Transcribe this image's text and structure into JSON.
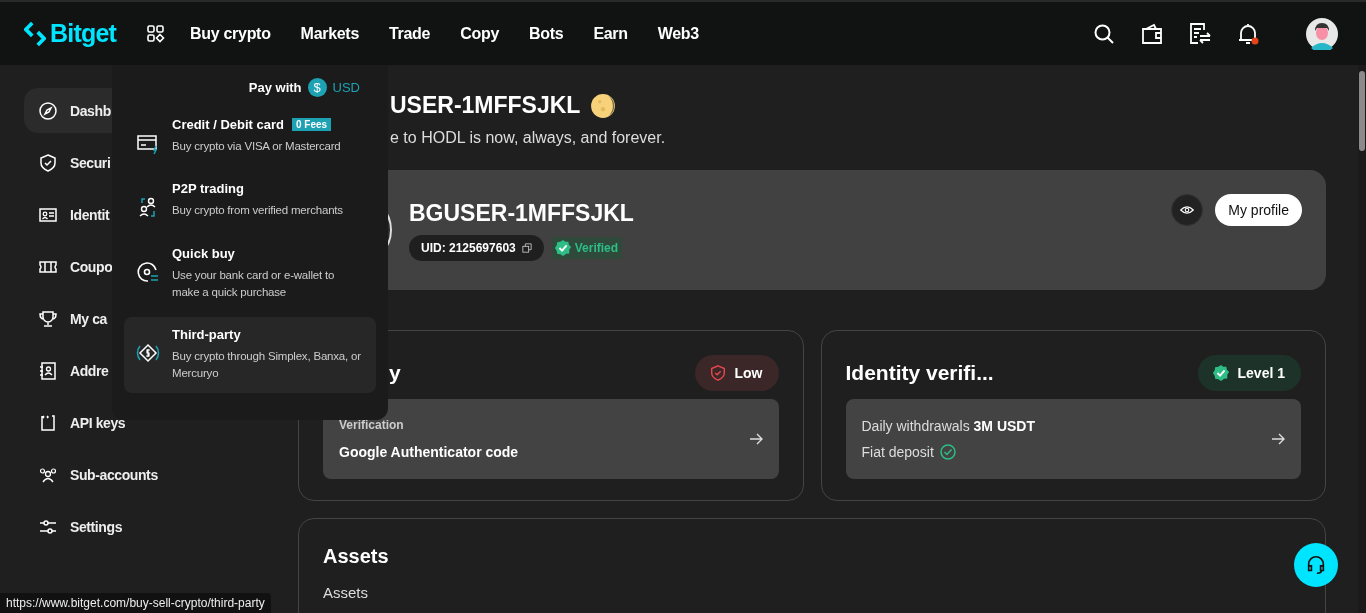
{
  "top_bar": {
    "logo": "Bitget",
    "nav": [
      {
        "label": "Buy crypto"
      },
      {
        "label": "Markets"
      },
      {
        "label": "Trade"
      },
      {
        "label": "Copy"
      },
      {
        "label": "Bots"
      },
      {
        "label": "Earn"
      },
      {
        "label": "Web3"
      }
    ],
    "notification_dot": true
  },
  "sidebar": {
    "items": [
      {
        "label": "Dashb",
        "kind": "compass",
        "selected": true
      },
      {
        "label": "Securi",
        "kind": "shield",
        "selected": false
      },
      {
        "label": "Identit",
        "kind": "idcard",
        "selected": false
      },
      {
        "label": "Coupo",
        "kind": "ticket",
        "selected": false
      },
      {
        "label": "My ca",
        "kind": "trophy",
        "selected": false
      },
      {
        "label": "Addre",
        "kind": "book",
        "selected": false
      },
      {
        "label": "API keys",
        "kind": "api",
        "selected": false
      },
      {
        "label": "Sub-accounts",
        "kind": "people",
        "selected": false
      },
      {
        "label": "Settings",
        "kind": "sliders",
        "selected": false
      }
    ]
  },
  "greeting": {
    "name": "USER-1MFFSJKL",
    "subtitle": "e to HODL is now, always, and forever."
  },
  "profile": {
    "name": "BGUSER-1MFFSJKL",
    "uid": "UID: 2125697603",
    "verified": "Verified",
    "button": "My profile"
  },
  "security": {
    "title": "y",
    "badge": "Low",
    "caption": "Verification",
    "method": "Google Authenticator code"
  },
  "identity": {
    "title": "Identity verifi...",
    "badge": "Level 1",
    "withdrawals_label": "Daily withdrawals",
    "withdrawals_value": "3M USDT",
    "fiat": "Fiat deposit"
  },
  "assets": {
    "title": "Assets",
    "subtitle": "Assets"
  },
  "buy_menu": {
    "pay_label": "Pay with",
    "currency_symbol": "$",
    "currency": "USD",
    "items": [
      {
        "kind": "card",
        "title": "Credit / Debit card",
        "badge": "0 Fees",
        "description": "Buy crypto via VISA or Mastercard",
        "highlighted": false
      },
      {
        "kind": "p2p",
        "title": "P2P trading",
        "description": "Buy crypto from verified merchants",
        "highlighted": false
      },
      {
        "kind": "quick",
        "title": "Quick buy",
        "description": "Use your bank card or e-wallet to make a quick purchase",
        "highlighted": false
      },
      {
        "kind": "third",
        "title": "Third-party",
        "description": "Buy crypto through Simplex, Banxa, or Mercuryo",
        "highlighted": true
      }
    ]
  },
  "status_url": "https://www.bitget.com/buy-sell-crypto/third-party"
}
